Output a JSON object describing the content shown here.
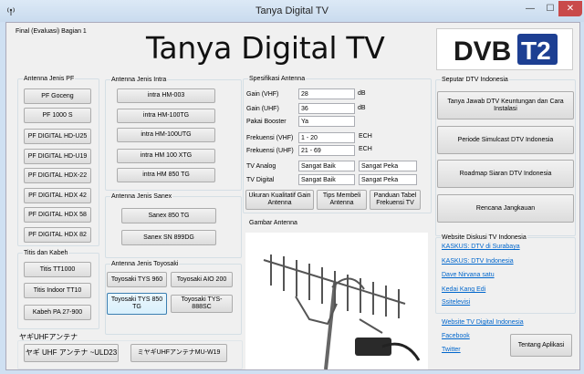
{
  "window": {
    "title": "Tanya Digital TV",
    "minimize_glyph": "—",
    "maximize_glyph": "☐",
    "close_glyph": "✕"
  },
  "header": {
    "subtitle": "Final (Evaluasi) Bagian 1",
    "app_title": "Tanya Digital TV",
    "logo_text_dvb": "DVB",
    "logo_text_t2": "T2"
  },
  "pf": {
    "group_label": "Antenna Jenis PF",
    "buttons": [
      "PF Goceng",
      "PF 1000 S",
      "PF DIGITAL HD-U25",
      "PF DIGITAL HD-U19",
      "PF DIGITAL HDX-22",
      "PF DIGITAL HDX 42",
      "PF DIGITAL HDX 58",
      "PF DIGITAL HDX 82"
    ]
  },
  "titis": {
    "group_label": "Titis dan Kabeh",
    "buttons": [
      "Titis TT1000",
      "Titis Indoor TT10",
      "Kabeh PA 27-900"
    ]
  },
  "yagi": {
    "group_label": "ヤギUHFアンテナ",
    "buttons": [
      "ヤギ UHF アンテナ ~ULD23",
      "ミヤギUHFアンテナMU-W19"
    ]
  },
  "intra": {
    "group_label": "Antenna Jenis Intra",
    "buttons": [
      "intra HM-003",
      "intra HM-100TG",
      "intra HM-100UTG",
      "intra HM 100 XTG",
      "intra HM 850 TG"
    ]
  },
  "sanex": {
    "group_label": "Antenna Jenis Sanex",
    "buttons": [
      "Sanex 850 TG",
      "Sanex SN 899DG"
    ]
  },
  "toyosaki": {
    "group_label": "Antenna Jenis Toyosaki",
    "buttons": [
      "Toyosaki TYS 960",
      "Toyosaki AIO 200",
      "Toyosaki TYS 850 TG",
      "Toyosaki TYS-888SC"
    ]
  },
  "spec": {
    "group_label": "Spesifikasi Antenna",
    "rows": [
      {
        "label": "Gain (VHF)",
        "value": "28",
        "unit": "dB"
      },
      {
        "label": "Gain (UHF)",
        "value": "36",
        "unit": "dB"
      },
      {
        "label": "Pakai Booster",
        "value": "Ya",
        "unit": ""
      },
      {
        "label": "Frekuensi (VHF)",
        "value": "1 - 20",
        "unit": "ECH"
      },
      {
        "label": "Frekuensi (UHF)",
        "value": "21 - 69",
        "unit": "ECH"
      }
    ],
    "analog_label": "TV Analog",
    "analog_values": [
      "Sangat Baik",
      "Sangat Peka"
    ],
    "digital_label": "TV Digital",
    "digital_values": [
      "Sangat Baik",
      "Sangat Peka"
    ],
    "buttons": [
      "Ukuran Kualitatif Gain Antenna",
      "Tips Membeli Antenna",
      "Panduan Tabel Frekuensi TV"
    ],
    "image_label": "Gambar Antenna"
  },
  "seputar": {
    "group_label": "Seputar DTV Indonesia",
    "buttons": [
      "Tanya Jawab DTV Keuntungan dan Cara Instalasi",
      "Periode Simulcast DTV Indonesia",
      "Roadmap Siaran DTV Indonesia",
      "Rencana Jangkauan"
    ]
  },
  "website": {
    "group_label": "Website Diskusi TV Indonesia",
    "links": [
      "KASKUS: DTV di Surabaya",
      "KASKUS: DTV Indonesia",
      "Dave Nirvana satu",
      "Kedai Kang Edi",
      "Ssitelevisi"
    ]
  },
  "footer": {
    "links": [
      "Website TV Digital Indonesia",
      "Facebook",
      "Twitter"
    ],
    "about_button": "Tentang Aplikasi"
  }
}
